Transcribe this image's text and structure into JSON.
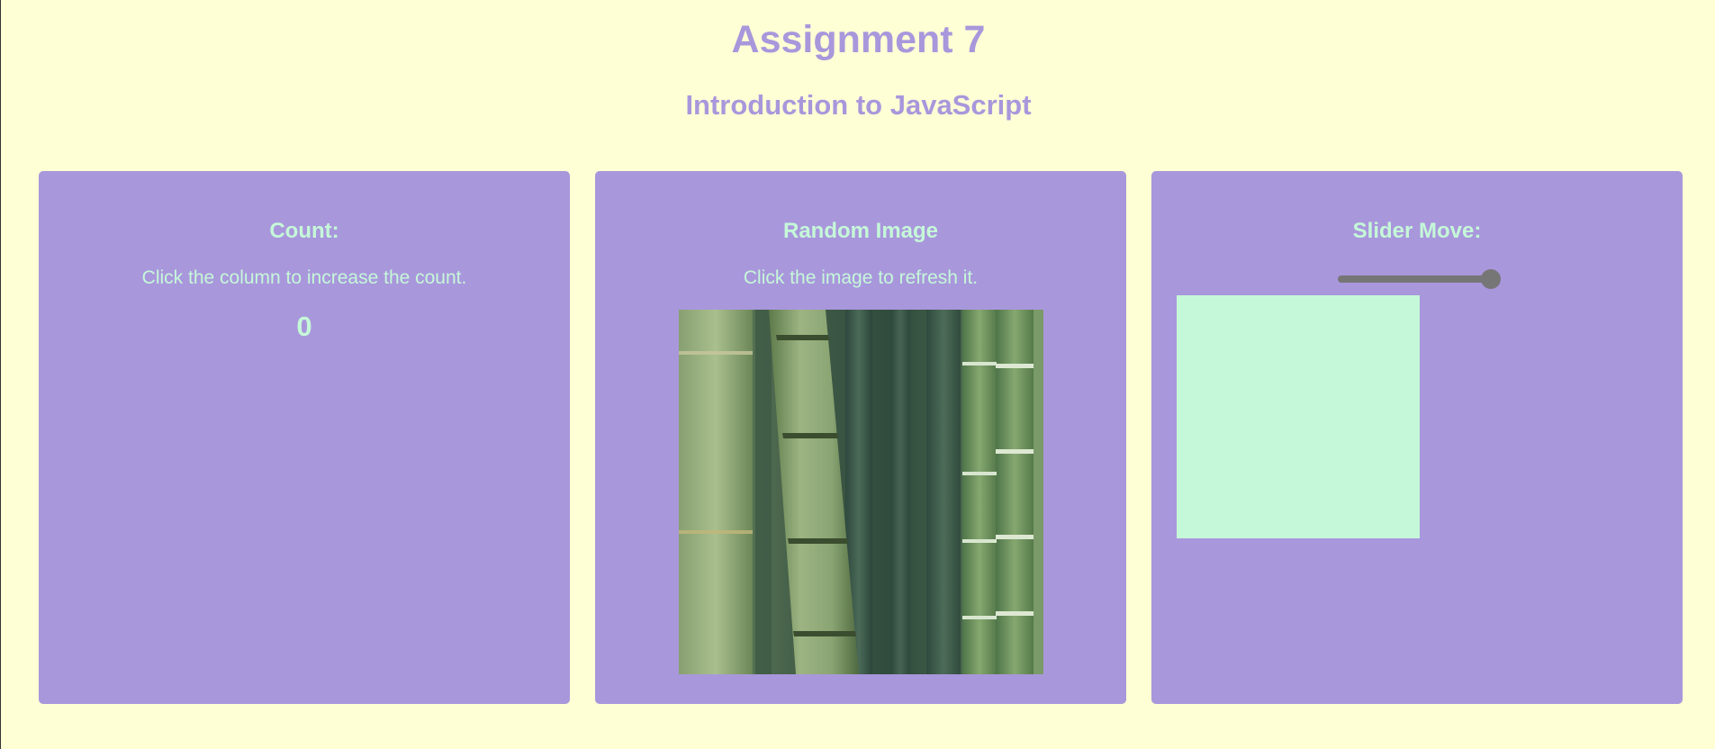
{
  "page": {
    "title": "Assignment 7",
    "subtitle": "Introduction to JavaScript"
  },
  "count_panel": {
    "title": "Count:",
    "description": "Click the column to increase the count.",
    "value": "0"
  },
  "image_panel": {
    "title": "Random Image",
    "description": "Click the image to refresh it.",
    "image_subject": "bamboo stalks"
  },
  "slider_panel": {
    "title": "Slider Move:",
    "slider_value_fraction": 1.0,
    "box_color": "#c5f8d8"
  },
  "colors": {
    "background": "#ffffd5",
    "accent": "#a997dc",
    "panel_text": "#c5f8d8",
    "slider": "#767676"
  }
}
